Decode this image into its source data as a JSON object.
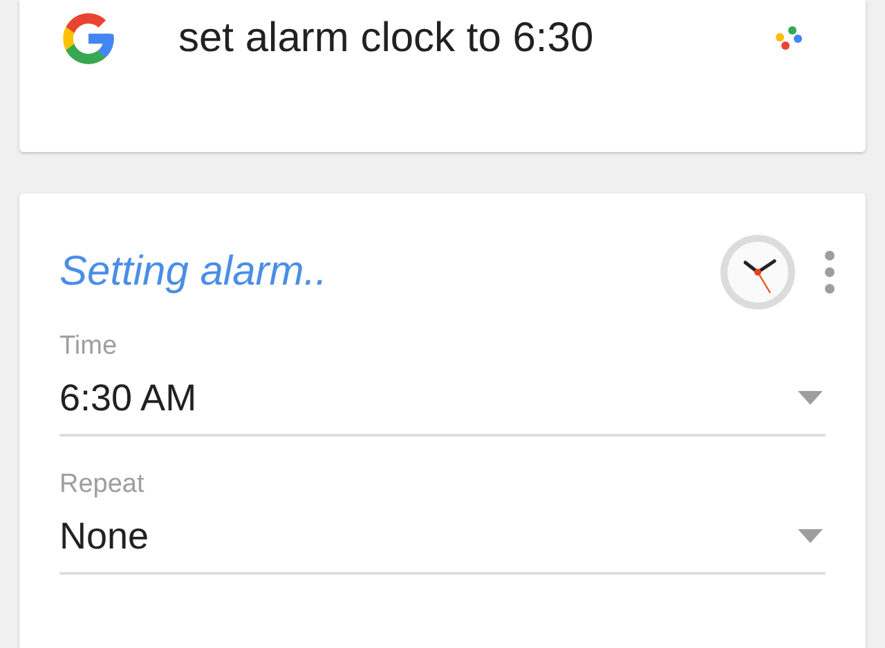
{
  "query": {
    "text": "set alarm clock to 6:30"
  },
  "alarm_card": {
    "title": "Setting alarm..",
    "fields": [
      {
        "label": "Time",
        "value": "6:30 AM"
      },
      {
        "label": "Repeat",
        "value": "None"
      }
    ]
  }
}
